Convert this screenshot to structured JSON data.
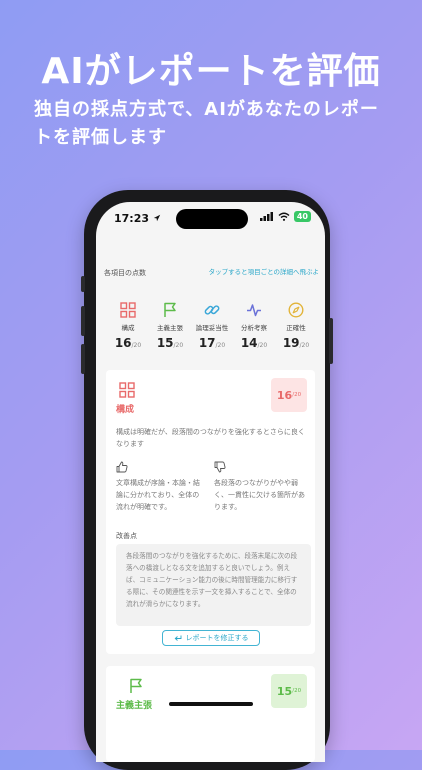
{
  "hero": {
    "title": "AIがレポートを評価",
    "subtitle": "独自の採点方式で、AIがあなたのレポートを評価します"
  },
  "status_bar": {
    "time": "17:23",
    "battery": "40"
  },
  "scores": {
    "heading": "各項目の点数",
    "hint_link": "タップすると項目ごとの詳細へ飛ぶよ",
    "items": [
      {
        "label": "構成",
        "value": "16",
        "max": "/20",
        "icon": "grid-icon",
        "color": "#e86a6a"
      },
      {
        "label": "主義主張",
        "value": "15",
        "max": "/20",
        "icon": "flag-icon",
        "color": "#5dbb4a"
      },
      {
        "label": "論理妥当性",
        "value": "17",
        "max": "/20",
        "icon": "link-icon",
        "color": "#3aa7d8"
      },
      {
        "label": "分析考察",
        "value": "14",
        "max": "/20",
        "icon": "pulse-icon",
        "color": "#6b72d8"
      },
      {
        "label": "正確性",
        "value": "19",
        "max": "/20",
        "icon": "compass-icon",
        "color": "#e2b43a"
      }
    ]
  },
  "detail": {
    "title": "構成",
    "score": "16",
    "max": "/20",
    "summary": "構成は明確だが、段落間のつながりを強化するとさらに良くなります",
    "good": "文章構成が序論・本論・結論に分かれており、全体の流れが明確です。",
    "bad": "各段落のつながりがやや弱く、一貫性に欠ける箇所があります。",
    "improve_label": "改善点",
    "improve_text": "各段落間のつながりを強化するために、段落末尾に次の段落への橋渡しとなる文を追加すると良いでしょう。例えば、コミュニケーション能力の後に時間管理能力に移行する際に、その関連性を示す一文を挿入することで、全体の流れが滑らかになります。",
    "fix_button": "レポートを修正する"
  },
  "next_card": {
    "title": "主義主張",
    "score": "15",
    "max": "/20"
  }
}
